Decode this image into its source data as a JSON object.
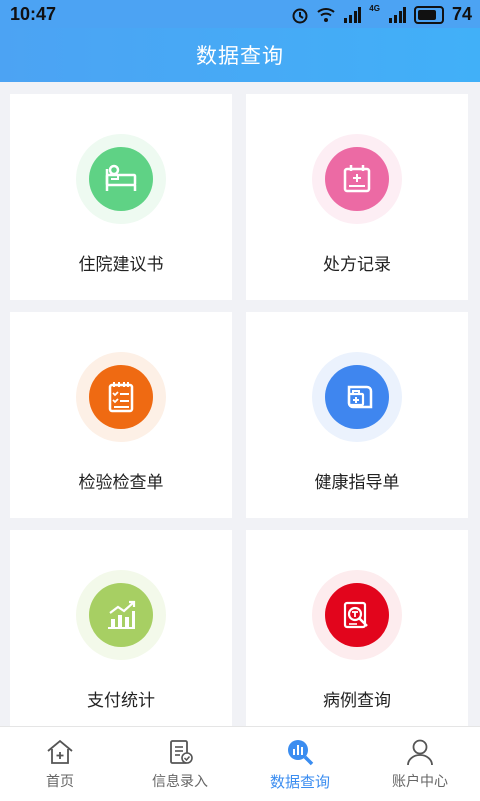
{
  "status_bar": {
    "time": "10:47",
    "battery": "74",
    "net1": "4G",
    "net2": "4G"
  },
  "header": {
    "title": "数据查询"
  },
  "cards": [
    {
      "label": "住院建议书",
      "icon": "hospital-bed-icon",
      "color": "#5fd285"
    },
    {
      "label": "处方记录",
      "icon": "calendar-plus-icon",
      "color": "#ec6aa4"
    },
    {
      "label": "检验检查单",
      "icon": "checklist-icon",
      "color": "#ef6a12"
    },
    {
      "label": "健康指导单",
      "icon": "medical-kit-icon",
      "color": "#3f86ef"
    },
    {
      "label": "支付统计",
      "icon": "bar-chart-icon",
      "color": "#a7cf63"
    },
    {
      "label": "病例查询",
      "icon": "case-search-icon",
      "color": "#e2051c"
    }
  ],
  "tabs": [
    {
      "label": "首页",
      "icon": "home-icon",
      "active": false
    },
    {
      "label": "信息录入",
      "icon": "document-edit-icon",
      "active": false
    },
    {
      "label": "数据查询",
      "icon": "data-search-icon",
      "active": true
    },
    {
      "label": "账户中心",
      "icon": "user-icon",
      "active": false
    }
  ],
  "colors": {
    "accent": "#3b8df0",
    "header": "#4ca3f3"
  }
}
